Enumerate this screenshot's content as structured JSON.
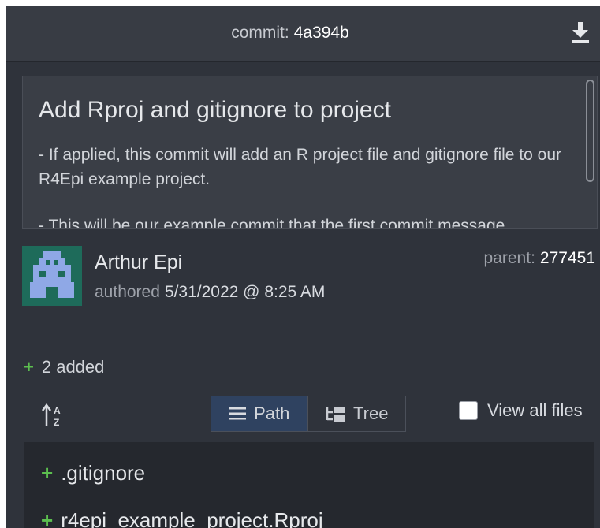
{
  "header": {
    "commit_label": "commit:",
    "commit_sha": "4a394b",
    "download_icon": "download-icon"
  },
  "message": {
    "title": "Add Rproj and gitignore to project",
    "paragraphs": [
      "- If applied, this commit will add an R project file and gitignore file to our R4Epi example project.",
      "- This will be our example commit that the first commit message"
    ]
  },
  "author": {
    "name": "Arthur Epi",
    "authored_label": "authored",
    "date": "5/31/2022 @ 8:25 AM",
    "parent_label": "parent:",
    "parent_sha": "277451"
  },
  "changes": {
    "summary": "2 added"
  },
  "toolbar": {
    "path_label": "Path",
    "tree_label": "Tree",
    "view_all_label": "View all files",
    "view_all_checked": false
  },
  "files": [
    {
      "name": ".gitignore",
      "status": "added"
    },
    {
      "name": "r4epi_example_project.Rproj",
      "status": "added"
    }
  ],
  "colors": {
    "panel_bg": "#2f333b",
    "added_green": "#5cbf4f",
    "active_toggle": "#2f4260"
  }
}
